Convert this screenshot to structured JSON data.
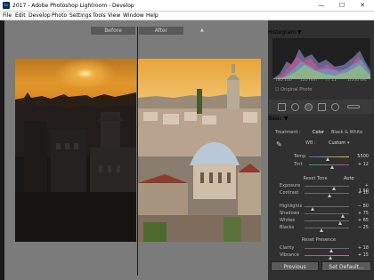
{
  "window": {
    "title": "2017 - Adobe Photoshop Lightroom - Develop",
    "minimize": "—",
    "maximize": "☐",
    "close": "✕"
  },
  "menu": [
    "File",
    "Edit",
    "Develop",
    "Photo",
    "Settings",
    "Tools",
    "View",
    "Window",
    "Help"
  ],
  "compare": {
    "before_label": "Before",
    "after_label": "After"
  },
  "histogram": {
    "title": "Histogram",
    "iso": "ISO 100",
    "focal": "120 mm",
    "aperture": "f / 11",
    "shutter": "1/100 sec",
    "original_photo": "Original Photo"
  },
  "basic": {
    "title": "Basic",
    "treatment_label": "Treatment :",
    "treatment_color": "Color",
    "treatment_bw": "Black & White",
    "wb_label": "WB :",
    "wb_value": "Custom",
    "temp_label": "Temp",
    "temp_value": "5500",
    "tint_label": "Tint",
    "tint_value": "+ 12",
    "reset_tone": "Reset Tone",
    "auto": "Auto",
    "sliders_tone": [
      {
        "label": "Exposure",
        "value": "+ 1.50",
        "pos": 0.65
      },
      {
        "label": "Contrast",
        "value": "+ 10",
        "pos": 0.55
      }
    ],
    "sliders_presence_tone": [
      {
        "label": "Highlights",
        "value": "− 80",
        "pos": 0.18
      },
      {
        "label": "Shadows",
        "value": "+ 75",
        "pos": 0.85
      },
      {
        "label": "Whites",
        "value": "+ 65",
        "pos": 0.8
      },
      {
        "label": "Blacks",
        "value": "− 25",
        "pos": 0.38
      }
    ],
    "reset_presence": "Reset Presence",
    "sliders_presence": [
      {
        "label": "Clarity",
        "value": "+ 18",
        "pos": 0.6
      },
      {
        "label": "Vibrance",
        "value": "+ 15",
        "pos": 0.58
      }
    ]
  },
  "buttons": {
    "previous": "Previous",
    "set_default": "Set Default..."
  },
  "colors": {
    "panel": "#303030",
    "workspace": "#7b7b7b",
    "accent": "#d6d6d6"
  }
}
